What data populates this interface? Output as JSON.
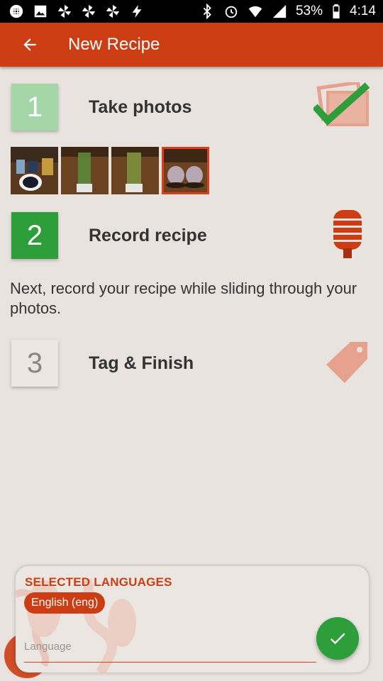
{
  "status_bar": {
    "battery_percent": "53%",
    "time": "4:14",
    "left_icons": [
      "slack-icon",
      "image-icon",
      "pinwheel-icon",
      "pinwheel-icon",
      "pinwheel-icon",
      "bolt-icon"
    ],
    "right_icons": [
      "bluetooth-icon",
      "alarm-icon",
      "wifi-icon",
      "signal-icon",
      "battery-icon"
    ]
  },
  "app_bar": {
    "title": "New Recipe",
    "back_icon": "arrow-left-icon",
    "color": "#cc3d14"
  },
  "steps": [
    {
      "number": "1",
      "title": "Take photos",
      "icon": "photos-check-icon"
    },
    {
      "number": "2",
      "title": "Record recipe",
      "icon": "microphone-icon",
      "description": "Next, record your recipe while sliding through your photos."
    },
    {
      "number": "3",
      "title": "Tag & Finish",
      "icon": "tag-icon"
    }
  ],
  "photos": [
    {
      "name": "ingredients-photo",
      "selected": false
    },
    {
      "name": "green-smoothie-photo",
      "selected": false
    },
    {
      "name": "blended-smoothie-photo",
      "selected": false
    },
    {
      "name": "two-cups-photo",
      "selected": true
    }
  ],
  "languages": {
    "header": "SELECTED LANGUAGES",
    "selected": [
      "English (eng)"
    ],
    "input_placeholder": "Language",
    "input_value": ""
  },
  "colors": {
    "accent": "#cc3d14",
    "step_done": "#a5d6a7",
    "step_active": "#2e9e3b",
    "confirm": "#2e9e3b"
  }
}
